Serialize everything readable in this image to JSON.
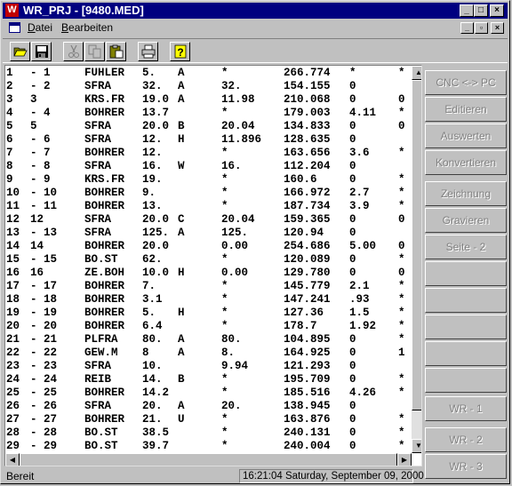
{
  "window": {
    "title": "WR_PRJ - [9480.MED]",
    "app_icon_letter": "W"
  },
  "caption_buttons": {
    "minimize": "_",
    "maximize": "□",
    "close": "×"
  },
  "mdi_buttons": {
    "minimize": "_",
    "restore": "▫",
    "close": "×"
  },
  "menu": {
    "items": [
      {
        "label": "Datei"
      },
      {
        "label": "Bearbeiten"
      }
    ]
  },
  "toolbar": {
    "buttons": [
      {
        "icon": "open-folder-icon",
        "enabled": true
      },
      {
        "icon": "save-disk-icon",
        "enabled": true
      },
      {
        "icon": "cut-scissors-icon",
        "enabled": false
      },
      {
        "icon": "copy-icon",
        "enabled": false
      },
      {
        "icon": "paste-icon",
        "enabled": true
      },
      {
        "icon": "print-icon",
        "enabled": true
      },
      {
        "icon": "help-icon",
        "enabled": true
      }
    ]
  },
  "table": {
    "rows": [
      [
        "1",
        "- 1",
        "FUHLER",
        "5.",
        "A",
        "*",
        "266.774",
        "*",
        "*"
      ],
      [
        "2",
        "- 2",
        "SFRA",
        "32.",
        "A",
        "32.",
        "154.155",
        "0",
        ""
      ],
      [
        "3",
        "3",
        "KRS.FR",
        "19.0",
        "A",
        "11.98",
        "210.068",
        "0",
        "0"
      ],
      [
        "4",
        "- 4",
        "BOHRER",
        "13.7",
        "",
        "*",
        "179.003",
        "4.11",
        "*"
      ],
      [
        "5",
        "5",
        "SFRA",
        "20.0",
        "B",
        "20.04",
        "134.833",
        "0",
        "0"
      ],
      [
        "6",
        "- 6",
        "SFRA",
        "12.",
        "H",
        "11.896",
        "128.635",
        "0",
        ""
      ],
      [
        "7",
        "- 7",
        "BOHRER",
        "12.",
        "",
        "*",
        "163.656",
        "3.6",
        "*"
      ],
      [
        "8",
        "- 8",
        "SFRA",
        "16.",
        "W",
        "16.",
        "112.204",
        "0",
        ""
      ],
      [
        "9",
        "- 9",
        "KRS.FR",
        "19.",
        "",
        "*",
        "160.6",
        "0",
        "*"
      ],
      [
        "10",
        "- 10",
        "BOHRER",
        "9.",
        "",
        "*",
        "166.972",
        "2.7",
        "*"
      ],
      [
        "11",
        "- 11",
        "BOHRER",
        "13.",
        "",
        "*",
        "187.734",
        "3.9",
        "*"
      ],
      [
        "12",
        "12",
        "SFRA",
        "20.0",
        "C",
        "20.04",
        "159.365",
        "0",
        "0"
      ],
      [
        "13",
        "- 13",
        "SFRA",
        "125.",
        "A",
        "125.",
        "120.94",
        "0",
        ""
      ],
      [
        "14",
        "14",
        "BOHRER",
        "20.0",
        "",
        "0.00",
        "254.686",
        "5.00",
        "0"
      ],
      [
        "15",
        "- 15",
        "BO.ST",
        "62.",
        "",
        "*",
        "120.089",
        "0",
        "*"
      ],
      [
        "16",
        "16",
        "ZE.BOH",
        "10.0",
        "H",
        "0.00",
        "129.780",
        "0",
        "0"
      ],
      [
        "17",
        "- 17",
        "BOHRER",
        "7.",
        "",
        "*",
        "145.779",
        "2.1",
        "*"
      ],
      [
        "18",
        "- 18",
        "BOHRER",
        "3.1",
        "",
        "*",
        "147.241",
        ".93",
        "*"
      ],
      [
        "19",
        "- 19",
        "BOHRER",
        "5.",
        "H",
        "*",
        "127.36",
        "1.5",
        "*"
      ],
      [
        "20",
        "- 20",
        "BOHRER",
        "6.4",
        "",
        "*",
        "178.7",
        "1.92",
        "*"
      ],
      [
        "21",
        "- 21",
        "PLFRA",
        "80.",
        "A",
        "80.",
        "104.895",
        "0",
        "*"
      ],
      [
        "22",
        "- 22",
        "GEW.M",
        "8",
        "A",
        "8.",
        "164.925",
        "0",
        "1"
      ],
      [
        "23",
        "- 23",
        "SFRA",
        "10.",
        "",
        "9.94",
        "121.293",
        "0",
        ""
      ],
      [
        "24",
        "- 24",
        "REIB",
        "14.",
        "B",
        "*",
        "195.709",
        "0",
        "*"
      ],
      [
        "25",
        "- 25",
        "BOHRER",
        "14.2",
        "",
        "*",
        "185.516",
        "4.26",
        "*"
      ],
      [
        "26",
        "- 26",
        "SFRA",
        "20.",
        "A",
        "20.",
        "138.945",
        "0",
        ""
      ],
      [
        "27",
        "- 27",
        "BOHRER",
        "21.",
        "U",
        "*",
        "163.876",
        "0",
        "*"
      ],
      [
        "28",
        "- 28",
        "BO.ST",
        "38.5",
        "",
        "*",
        "240.131",
        "0",
        "*"
      ],
      [
        "29",
        "- 29",
        "BO.ST",
        "39.7",
        "",
        "*",
        "240.004",
        "0",
        "*"
      ]
    ]
  },
  "side_buttons": [
    {
      "label": "CNC <-> PC"
    },
    {
      "label": "Editieren"
    },
    {
      "label": "Auswerten"
    },
    {
      "label": "Konvertieren"
    },
    {
      "label": "Zeichnung"
    },
    {
      "label": "Gravieren"
    },
    {
      "label": "Seite - 2"
    },
    {
      "label": ""
    },
    {
      "label": ""
    },
    {
      "label": ""
    },
    {
      "label": ""
    },
    {
      "label": ""
    },
    {
      "label": "WR - 1"
    },
    {
      "label": "WR - 2"
    },
    {
      "label": "WR - 3"
    }
  ],
  "status": {
    "left": "Bereit",
    "right": "16:21:04 Saturday, September 09, 2000"
  },
  "colors": {
    "title_bg": "#000080",
    "face": "#c0c0c0",
    "disabled_text": "#808080"
  }
}
